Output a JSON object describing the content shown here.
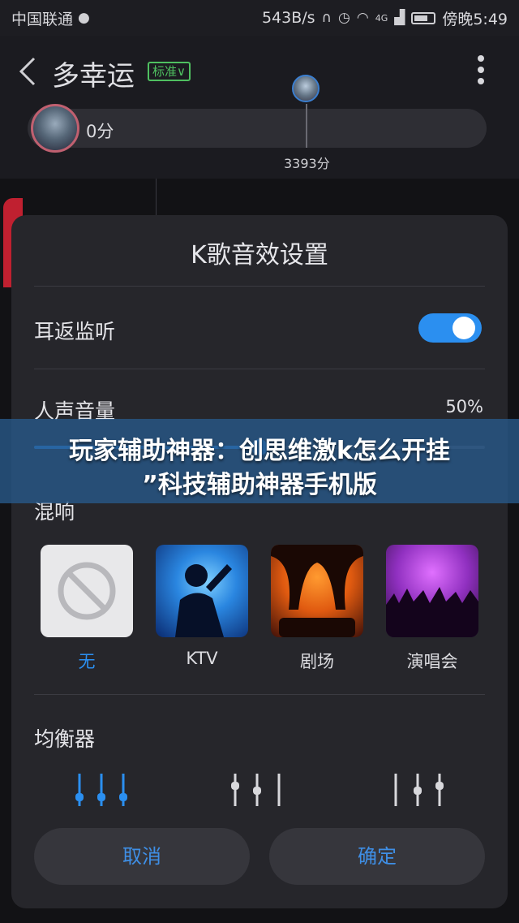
{
  "status_bar": {
    "carrier": "中国联通",
    "speed": "543B/s",
    "network": "4G",
    "time": "傍晚5:49"
  },
  "header": {
    "song_title": "多幸运",
    "quality_badge": "标准∨",
    "my_score": "0分",
    "peer_score": "3393分"
  },
  "dialog": {
    "title": "K歌音效设置",
    "monitor_label": "耳返监听",
    "monitor_enabled": true,
    "volume_label": "人声音量",
    "volume_value": "50%",
    "volume_fraction": 0.5,
    "reverb_label": "混响",
    "reverb_options": [
      {
        "label": "无",
        "selected": true,
        "icon": "no-effect-icon"
      },
      {
        "label": "KTV",
        "selected": false,
        "icon": "singer-icon"
      },
      {
        "label": "剧场",
        "selected": false,
        "icon": "theater-icon"
      },
      {
        "label": "演唱会",
        "selected": false,
        "icon": "concert-icon"
      }
    ],
    "eq_label": "均衡器",
    "cancel_label": "取消",
    "confirm_label": "确定"
  },
  "overlay": {
    "line1": "玩家辅助神器：创思维激k怎么开挂",
    "line2": "”科技辅助神器手机版"
  },
  "colors": {
    "accent": "#2b8ff0",
    "button_text": "#3f8fe6",
    "badge_green": "#4fc060",
    "dialog_bg": "#26262b"
  }
}
